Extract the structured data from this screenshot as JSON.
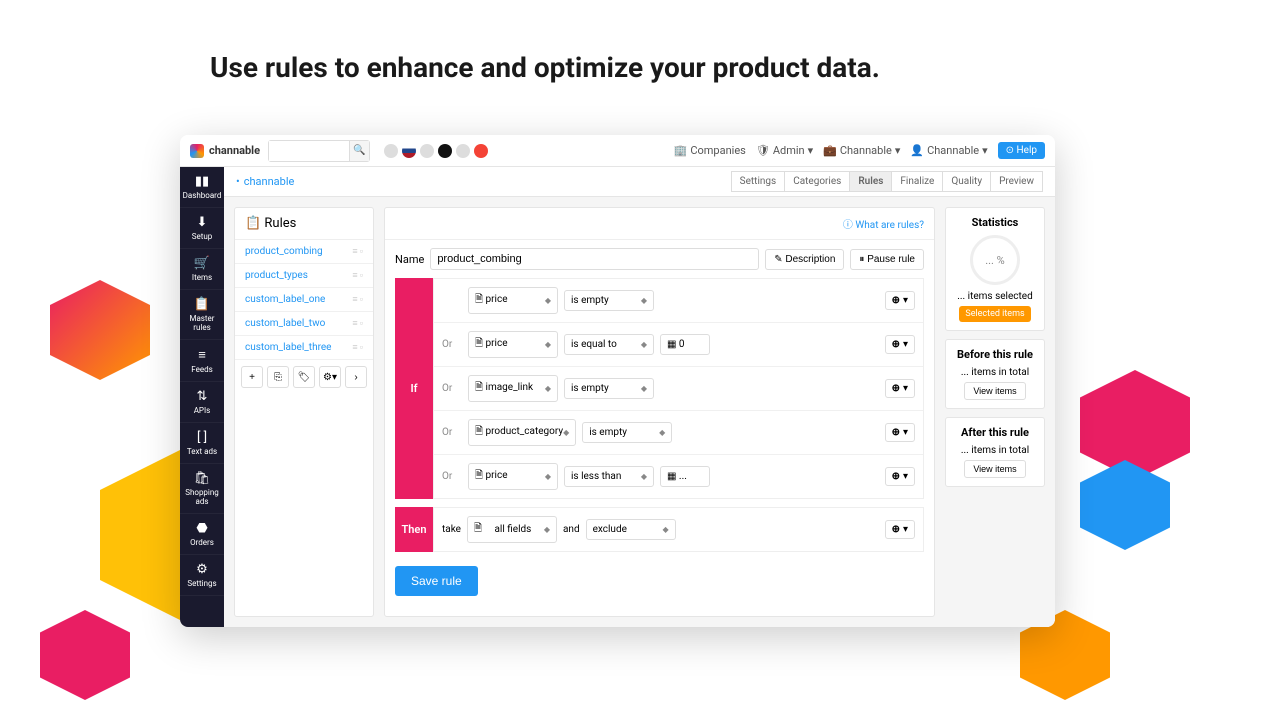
{
  "headline": "Use rules to enhance and optimize your product data.",
  "brand": "channable",
  "topbar": {
    "companies": "Companies",
    "admin": "Admin",
    "org": "Channable",
    "user": "Channable",
    "help": "Help"
  },
  "sidebar": [
    "Dashboard",
    "Setup",
    "Items",
    "Master rules",
    "Feeds",
    "APIs",
    "Text ads",
    "Shopping ads",
    "Orders",
    "Settings"
  ],
  "sidebar_icons": [
    "▮▮",
    "⬇",
    "🛒",
    "📋",
    "≡",
    "⇅",
    "[ ]",
    "🛍",
    "⬣",
    "⚙"
  ],
  "breadcrumb": "channable",
  "steps": [
    "Settings",
    "Categories",
    "Rules",
    "Finalize",
    "Quality",
    "Preview"
  ],
  "active_step": 2,
  "rules_title": "Rules",
  "what_link": "What are rules?",
  "rule_items": [
    "product_combing",
    "product_types",
    "custom_label_one",
    "custom_label_two",
    "custom_label_three"
  ],
  "name_label": "Name",
  "rule_name": "product_combing",
  "desc_btn": "Description",
  "pause_btn": "Pause rule",
  "if_label": "If",
  "then_label": "Then",
  "or_label": "Or",
  "conditions": [
    {
      "field": "price",
      "op": "is empty",
      "val": ""
    },
    {
      "field": "price",
      "op": "is equal to",
      "val": "0"
    },
    {
      "field": "image_link",
      "op": "is empty",
      "val": ""
    },
    {
      "field": "product_category",
      "op": "is empty",
      "val": ""
    },
    {
      "field": "price",
      "op": "is less than",
      "val": "..."
    }
  ],
  "then": {
    "verb": "take",
    "field": "all fields",
    "conj": "and",
    "action": "exclude"
  },
  "save": "Save rule",
  "stats": {
    "title": "Statistics",
    "pct": "... %",
    "items_sel": "... items selected",
    "selected_btn": "Selected items",
    "before_title": "Before this rule",
    "before_txt": "... items in total",
    "after_title": "After this rule",
    "after_txt": "... items in total",
    "view": "View items"
  }
}
